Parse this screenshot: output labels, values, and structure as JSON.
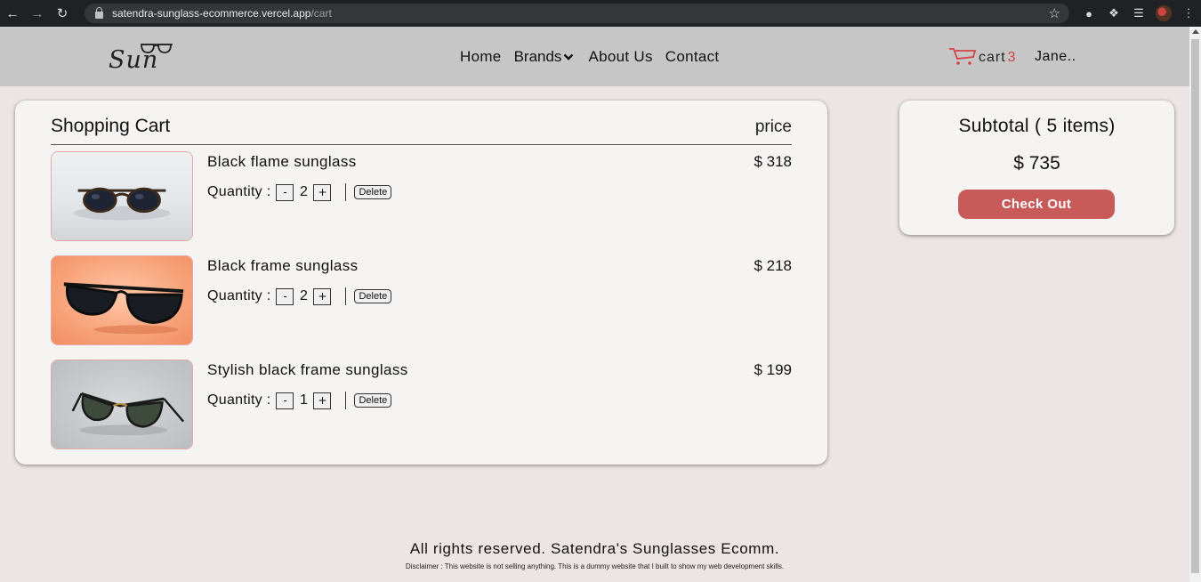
{
  "browser": {
    "url_host": "satendra-sunglass-ecommerce.vercel.app",
    "url_path": "/cart",
    "back_icon": "arrow-left-icon",
    "forward_icon": "arrow-right-icon",
    "reload_icon": "reload-icon"
  },
  "header": {
    "logo_text": "Sun",
    "nav": {
      "home": "Home",
      "brands": "Brands",
      "about": "About Us",
      "contact": "Contact"
    },
    "cart_label": "cart",
    "cart_count": "3",
    "user_name": "Jane.."
  },
  "cart": {
    "title": "Shopping Cart",
    "price_header": "price",
    "quantity_label": "Quantity :",
    "minus_label": "-",
    "plus_label": "+",
    "delete_label": "Delete",
    "items": [
      {
        "name": "Black flame sunglass",
        "price": "$ 318",
        "quantity": "2"
      },
      {
        "name": "Black frame sunglass",
        "price": "$ 218",
        "quantity": "2"
      },
      {
        "name": "Stylish black frame sunglass",
        "price": "$ 199",
        "quantity": "1"
      }
    ]
  },
  "subtotal": {
    "title": "Subtotal ( 5 items)",
    "amount": "$ 735",
    "checkout_label": "Check Out"
  },
  "footer": {
    "rights": "All rights reserved. Satendra's Sunglasses Ecomm.",
    "disclaimer": "Disclaimer : This website is not selling anything. This is a dummy website that I built to show my web development skills."
  },
  "colors": {
    "accent": "#c85a5a",
    "header_bg": "#c6c6c6",
    "page_bg": "#ede4e5",
    "cart_count": "#d34545"
  }
}
